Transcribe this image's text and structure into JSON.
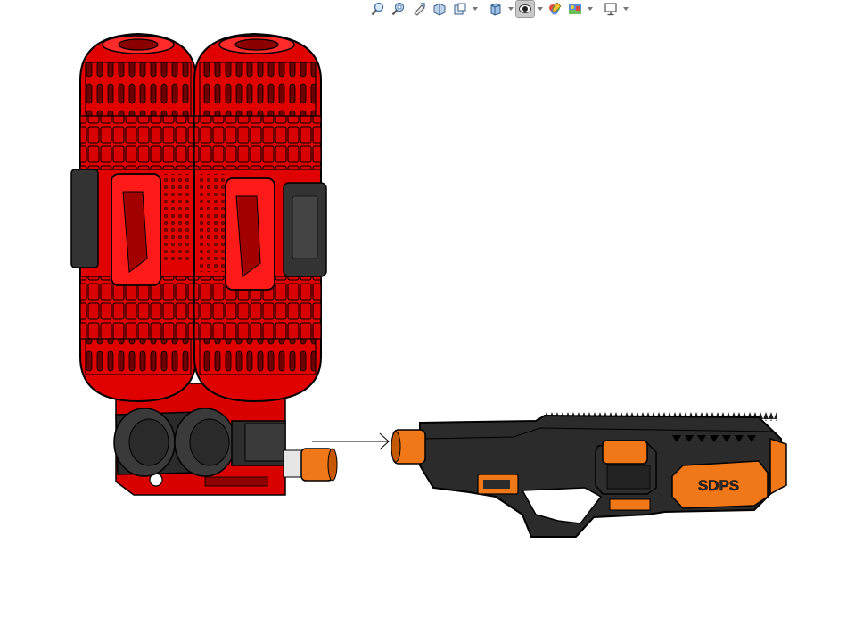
{
  "colors": {
    "tank_red": "#e10000",
    "tank_dark_red": "#8e0000",
    "body_black": "#2b2b2b",
    "accent_orange": "#f07818",
    "outline": "#000000",
    "background": "#ffffff"
  },
  "toolbar": {
    "items": [
      {
        "icon": "zoom-to-fit-icon"
      },
      {
        "icon": "zoom-to-area-icon"
      },
      {
        "icon": "previous-view-icon"
      },
      {
        "icon": "section-view-icon"
      },
      {
        "icon": "dynamic-annotation-icon",
        "dropdown": true
      },
      {
        "icon": "view-orientation-icon",
        "dropdown": true
      },
      {
        "icon": "display-style-icon",
        "dropdown": true,
        "active": true
      },
      {
        "icon": "hide-show-items-icon",
        "dropdown": true
      },
      {
        "icon": "edit-appearance-icon"
      },
      {
        "icon": "apply-scene-icon",
        "dropdown": true
      },
      {
        "icon": "view-settings-icon",
        "dropdown": true
      }
    ]
  },
  "models": [
    {
      "name": "twin-tank-pack",
      "color": "#e10000"
    },
    {
      "name": "blaster-body",
      "color": "#2b2b2b",
      "accent": "#f07818",
      "emboss_text": "SDPS"
    }
  ]
}
